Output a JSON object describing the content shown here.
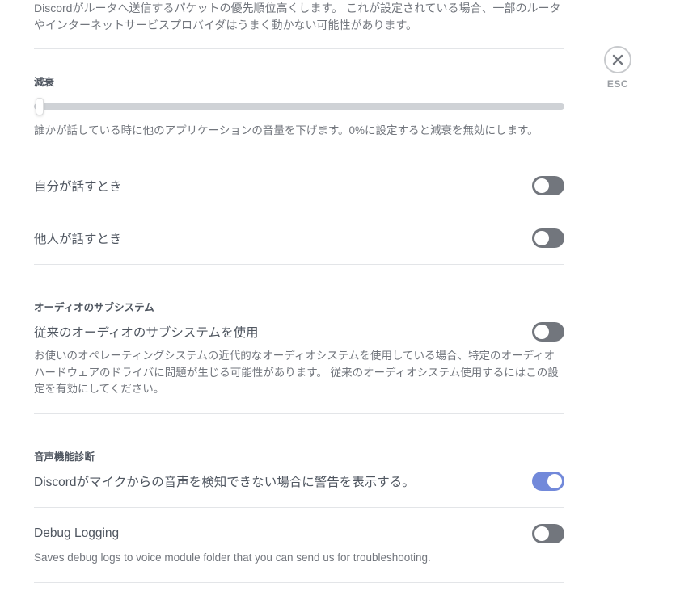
{
  "qos": {
    "description": "Discordがルータへ送信するパケットの優先順位高くします。 これが設定されている場合、一部のルータやインターネットサービスプロバイダはうまく動かない可能性があります。"
  },
  "attenuation": {
    "header": "減衰",
    "description": "誰かが話している時に他のアプリケーションの音量を下げます。0%に設定すると減衰を無効にします。"
  },
  "toggles": {
    "when_i_speak": {
      "label": "自分が話すとき",
      "state": false
    },
    "when_others_speak": {
      "label": "他人が話すとき",
      "state": false
    }
  },
  "audio_subsystem": {
    "header": "オーディオのサブシステム",
    "label": "従来のオーディオのサブシステムを使用",
    "description": "お使いのオペレーティングシステムの近代的なオーディオシステムを使用している場合、特定のオーディオハードウェアのドライバに問題が生じる可能性があります。 従来のオーディオシステム使用するにはこの設定を有効にしてください。",
    "state": false
  },
  "voice_diagnostics": {
    "header": "音声機能診断",
    "label": "Discordがマイクからの音声を検知できない場合に警告を表示する。",
    "state": true
  },
  "debug_logging": {
    "label": "Debug Logging",
    "description": "Saves debug logs to voice module folder that you can send us for troubleshooting.",
    "state": false
  },
  "close": {
    "esc": "ESC"
  }
}
